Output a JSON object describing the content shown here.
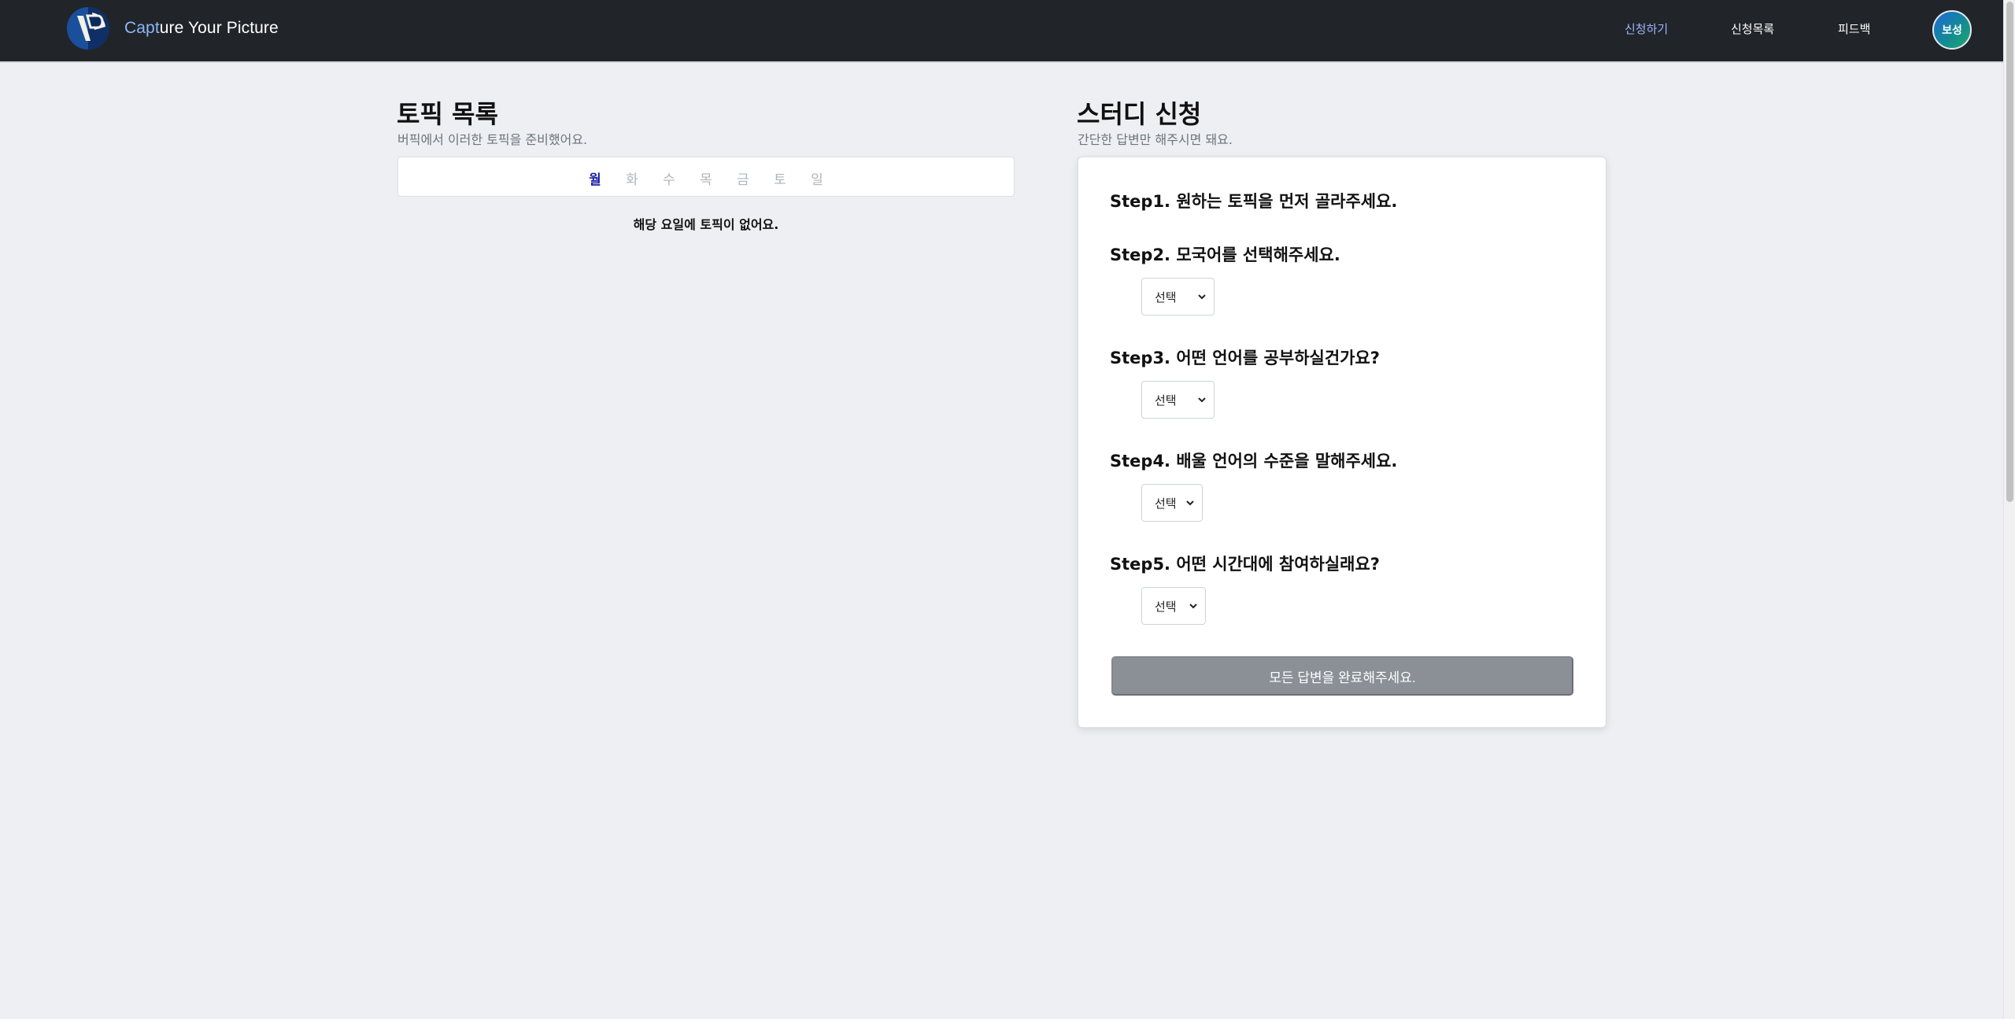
{
  "navbar": {
    "brand_prefix": "Capt",
    "brand_rest": "ure Your Picture",
    "links": [
      {
        "label": "신청하기",
        "active": true
      },
      {
        "label": "신청목록",
        "active": false
      },
      {
        "label": "피드백",
        "active": false
      }
    ],
    "avatar_label": "보성"
  },
  "topics": {
    "title": "토픽 목록",
    "subtitle": "버픽에서 이러한 토픽을 준비했어요.",
    "days": [
      "월",
      "화",
      "수",
      "목",
      "금",
      "토",
      "일"
    ],
    "active_day": "월",
    "empty_message": "해당 요일에 토픽이 없어요."
  },
  "study": {
    "title": "스터디 신청",
    "subtitle": "간단한 답변만 해주시면 돼요.",
    "steps": [
      {
        "label": "Step1. 원하는 토픽을 먼저 골라주세요."
      },
      {
        "label": "Step2. 모국어를 선택해주세요.",
        "select_value": "선택"
      },
      {
        "label": "Step3. 어떤 언어를 공부하실건가요?",
        "select_value": "선택"
      },
      {
        "label": "Step4. 배울 언어의 수준을 말해주세요.",
        "select_value": "선택"
      },
      {
        "label": "Step5. 어떤 시간대에 참여하실래요?",
        "select_value": "선택"
      }
    ],
    "submit_label": "모든 답변을 완료해주세요."
  },
  "colors": {
    "navbar_bg": "#212529",
    "active_nav": "#9bb3ff",
    "active_day": "#1f1fa8",
    "disabled_button": "#8b9096"
  },
  "icons": [
    "logo-icon",
    "chevron-down-icon"
  ]
}
